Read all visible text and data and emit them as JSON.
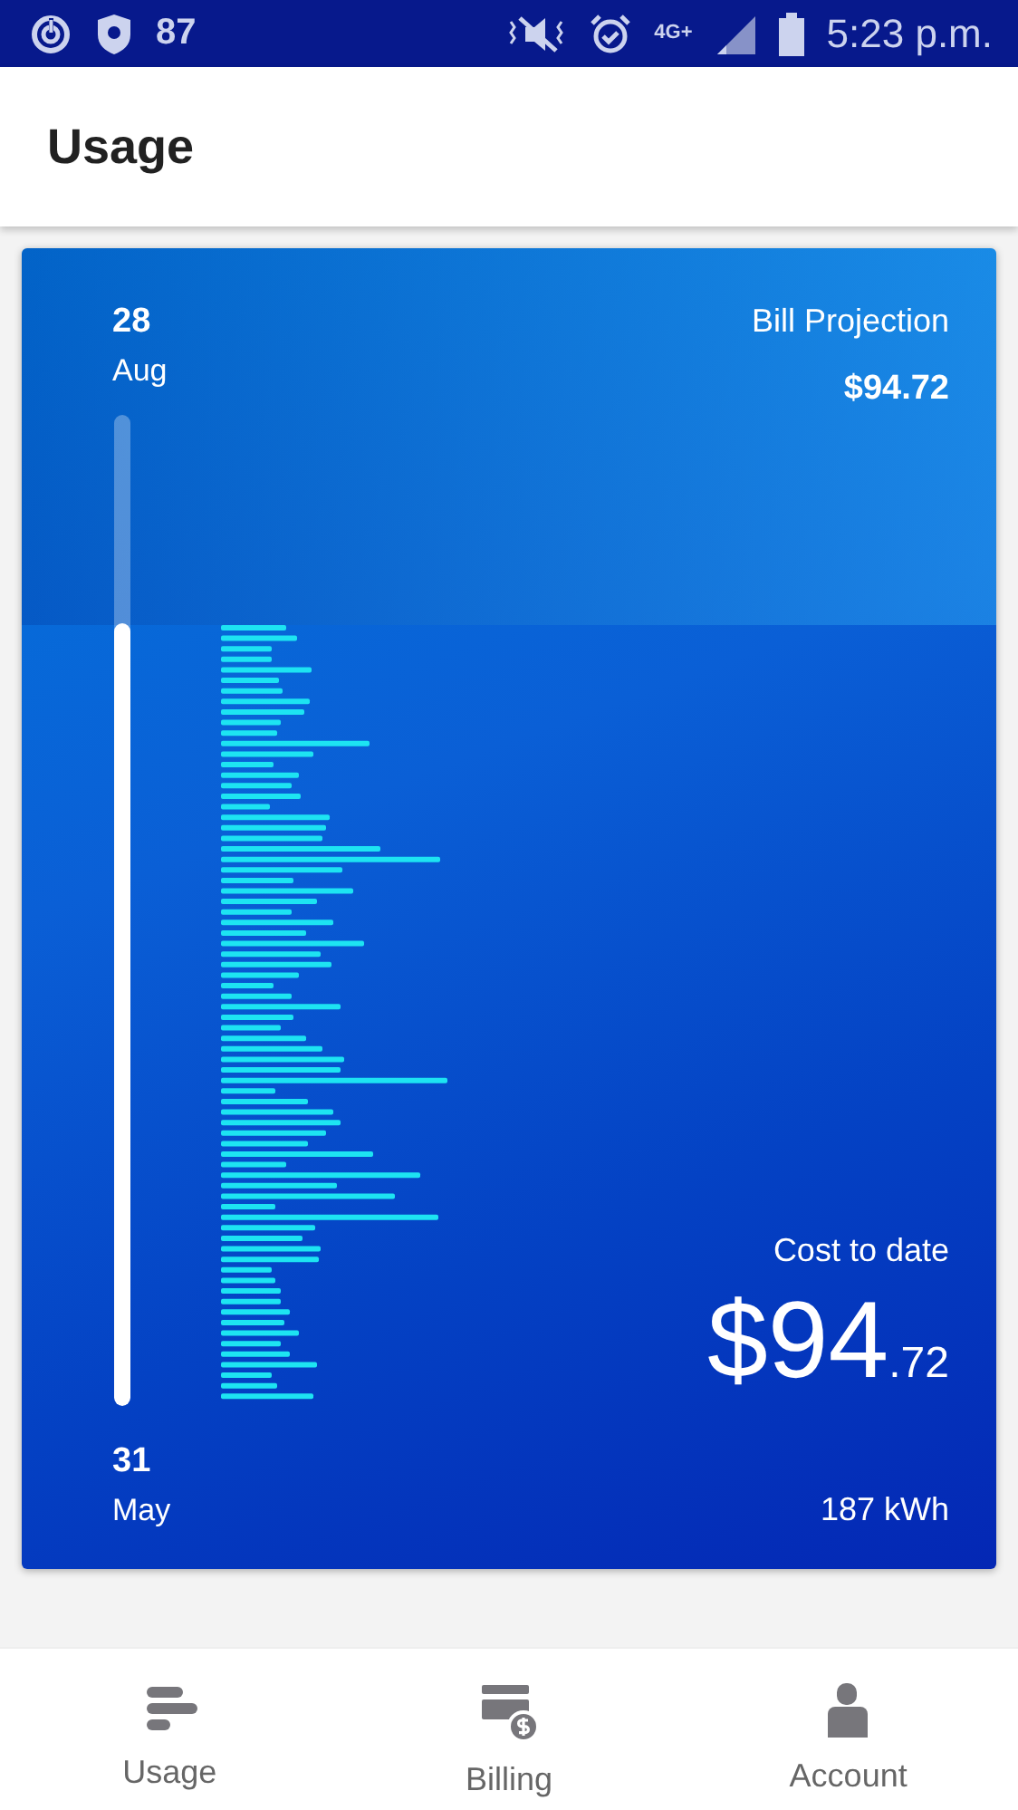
{
  "status_bar": {
    "battery_percent": "87",
    "network": "4G+",
    "time": "5:23 p.m."
  },
  "header": {
    "title": "Usage"
  },
  "usage_card": {
    "start": {
      "day": "28",
      "month": "Aug"
    },
    "end": {
      "day": "31",
      "month": "May"
    },
    "range_slider": {
      "level": 0.79
    },
    "bill_projection": {
      "label": "Bill Projection",
      "value": "$94.72"
    },
    "cost_to_date": {
      "label": "Cost to date",
      "value": "$94$_{.72}$"
    },
    "energy": "187 kWh"
  },
  "bottom_nav": [
    {
      "kind": "usage",
      "label": "Usage"
    },
    {
      "kind": "billing",
      "label": "Billing"
    },
    {
      "kind": "account",
      "label": "Account"
    }
  ]
}
